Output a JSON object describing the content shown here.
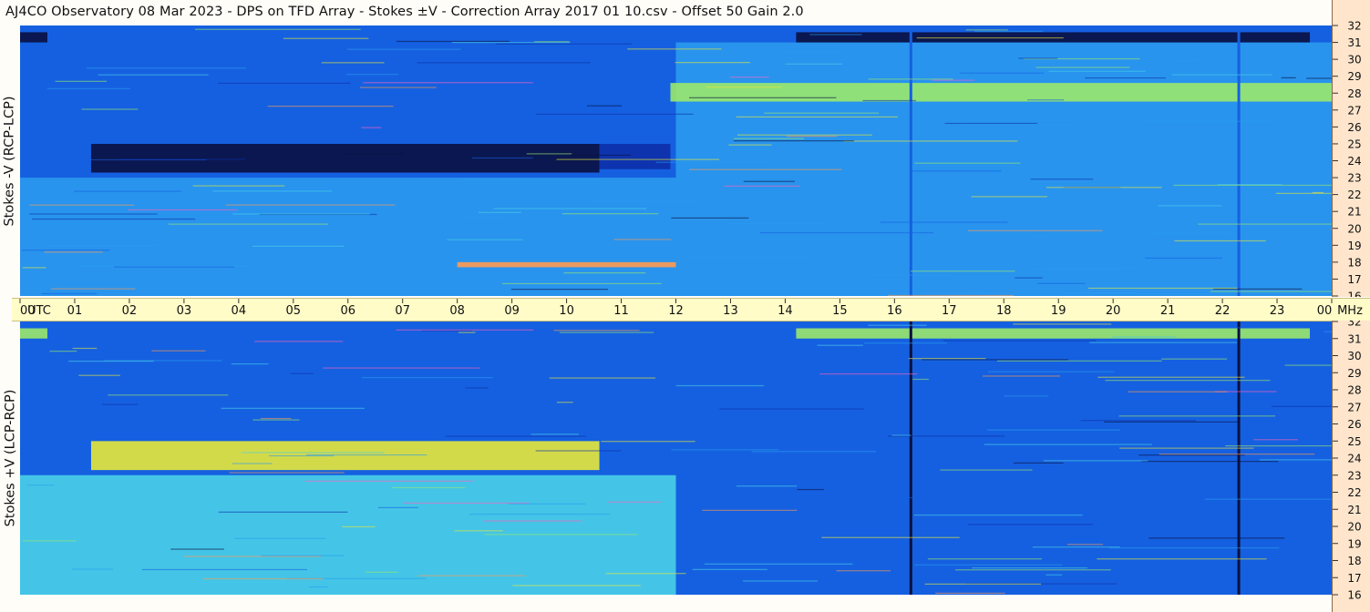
{
  "header": {
    "title": "AJ4CO Observatory  08 Mar 2023  -  DPS on TFD Array  -  Stokes ±V  -  Correction Array 2017 01 10.csv  -  Offset 50  Gain 2.0"
  },
  "panels": {
    "top_label": "Stokes -V (RCP-LCP)",
    "bottom_label": "Stokes +V (LCP-RCP)"
  },
  "chart_data": {
    "type": "heatmap",
    "title": "AJ4CO Observatory  08 Mar 2023  -  DPS on TFD Array  -  Stokes ±V  -  Correction Array 2017 01 10.csv  -  Offset 50  Gain 2.0",
    "xlabel": "UTC",
    "ylabel": "MHz",
    "x_ticks": [
      "00",
      "01",
      "02",
      "03",
      "04",
      "05",
      "06",
      "07",
      "08",
      "09",
      "10",
      "11",
      "12",
      "13",
      "14",
      "15",
      "16",
      "17",
      "18",
      "19",
      "20",
      "21",
      "22",
      "23",
      "00"
    ],
    "x_axis_unit": "UTC",
    "y_axis_unit": "MHz",
    "y_ticks": [
      16,
      17,
      18,
      19,
      20,
      21,
      22,
      23,
      24,
      25,
      26,
      27,
      28,
      29,
      30,
      31,
      32
    ],
    "xlim_hours": [
      0,
      24
    ],
    "ylim_mhz": [
      16,
      32
    ],
    "colormap": [
      "#0a1040",
      "#0d2fa8",
      "#1560e0",
      "#2a9af0",
      "#49d0e8",
      "#9ae86a",
      "#e8e838",
      "#ff9a50",
      "#ff60c0"
    ],
    "panels": [
      {
        "name": "Stokes -V (RCP-LCP)",
        "features": [
          {
            "kind": "band",
            "t": [
              1.3,
              10.6
            ],
            "f": [
              23.3,
              25.0
            ],
            "level": 0.02
          },
          {
            "kind": "band",
            "t": [
              10.6,
              11.9
            ],
            "f": [
              23.5,
              25.0
            ],
            "level": 0.1
          },
          {
            "kind": "band",
            "t": [
              0.0,
              12.0
            ],
            "f": [
              25.0,
              31.0
            ],
            "level": 0.26
          },
          {
            "kind": "band",
            "t": [
              0.0,
              12.0
            ],
            "f": [
              16.0,
              23.0
            ],
            "level": 0.36
          },
          {
            "kind": "band",
            "t": [
              12.0,
              24.0
            ],
            "f": [
              16.0,
              31.0
            ],
            "level": 0.42
          },
          {
            "kind": "band",
            "t": [
              11.9,
              24.0
            ],
            "f": [
              27.5,
              28.6
            ],
            "level": 0.58
          },
          {
            "kind": "band",
            "t": [
              0.0,
              0.5
            ],
            "f": [
              31.0,
              31.6
            ],
            "level": 0.0
          },
          {
            "kind": "band",
            "t": [
              14.2,
              23.6
            ],
            "f": [
              31.0,
              31.6
            ],
            "level": 0.0
          },
          {
            "kind": "band",
            "t": [
              8.0,
              12.0
            ],
            "f": [
              17.7,
              18.0
            ],
            "level": 0.82
          },
          {
            "kind": "vline",
            "t": 16.3,
            "level": 0.3
          },
          {
            "kind": "vline",
            "t": 22.3,
            "level": 0.3
          }
        ]
      },
      {
        "name": "Stokes +V (LCP-RCP)",
        "features": [
          {
            "kind": "band",
            "t": [
              1.3,
              10.6
            ],
            "f": [
              23.3,
              25.0
            ],
            "level": 0.74
          },
          {
            "kind": "band",
            "t": [
              0.0,
              12.0
            ],
            "f": [
              25.0,
              31.0
            ],
            "level": 0.3
          },
          {
            "kind": "band",
            "t": [
              0.0,
              12.0
            ],
            "f": [
              16.0,
              23.0
            ],
            "level": 0.44
          },
          {
            "kind": "band",
            "t": [
              12.0,
              24.0
            ],
            "f": [
              16.0,
              31.0
            ],
            "level": 0.24
          },
          {
            "kind": "band",
            "t": [
              0.0,
              0.5
            ],
            "f": [
              31.0,
              31.6
            ],
            "level": 0.68
          },
          {
            "kind": "band",
            "t": [
              14.2,
              23.6
            ],
            "f": [
              31.0,
              31.6
            ],
            "level": 0.6
          },
          {
            "kind": "vline",
            "t": 16.3,
            "level": 0.0
          },
          {
            "kind": "vline",
            "t": 22.3,
            "level": 0.0
          }
        ]
      }
    ]
  }
}
